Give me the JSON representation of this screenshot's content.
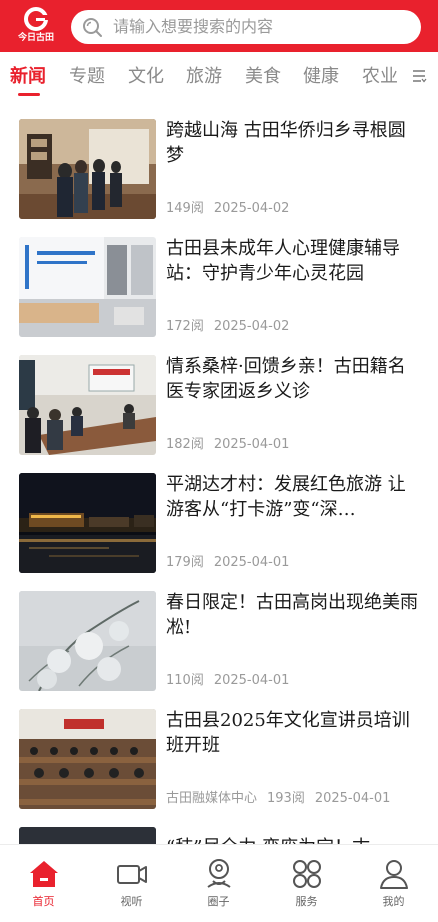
{
  "header": {
    "logo_text": "今日古田",
    "search_placeholder": "请输入想要搜索的内容"
  },
  "tabs": [
    {
      "label": "新闻",
      "active": true
    },
    {
      "label": "专题",
      "active": false
    },
    {
      "label": "文化",
      "active": false
    },
    {
      "label": "旅游",
      "active": false
    },
    {
      "label": "美食",
      "active": false
    },
    {
      "label": "健康",
      "active": false
    },
    {
      "label": "农业",
      "active": false
    }
  ],
  "articles": [
    {
      "title": "跨越山海 古田华侨归乡寻根圆梦",
      "source": "",
      "reads": "149阅",
      "date": "2025-04-02"
    },
    {
      "title": "古田县未成年人心理健康辅导站：守护青少年心灵花园",
      "source": "",
      "reads": "172阅",
      "date": "2025-04-02"
    },
    {
      "title": "情系桑梓·回馈乡亲！古田籍名医专家团返乡义诊",
      "source": "",
      "reads": "182阅",
      "date": "2025-04-01"
    },
    {
      "title": "平湖达才村：发展红色旅游 让游客从“打卡游”变“深…",
      "source": "",
      "reads": "179阅",
      "date": "2025-04-01"
    },
    {
      "title": "春日限定！古田高岗出现绝美雨凇!",
      "source": "",
      "reads": "110阅",
      "date": "2025-04-01"
    },
    {
      "title": "古田县2025年文化宣讲员培训班开班",
      "source": "古田融媒体中心",
      "reads": "193阅",
      "date": "2025-04-01"
    },
    {
      "title": "“秸”尽全力 变废为宝！古",
      "source": "",
      "reads": "",
      "date": ""
    }
  ],
  "bottom_nav": [
    {
      "label": "首页",
      "icon": "home-icon",
      "active": true
    },
    {
      "label": "视听",
      "icon": "video-icon",
      "active": false
    },
    {
      "label": "圈子",
      "icon": "community-icon",
      "active": false
    },
    {
      "label": "服务",
      "icon": "services-grid-icon",
      "active": false
    },
    {
      "label": "我的",
      "icon": "profile-icon",
      "active": false
    }
  ],
  "colors": {
    "brand": "#e9212d",
    "muted_text": "#9a9a9a"
  }
}
